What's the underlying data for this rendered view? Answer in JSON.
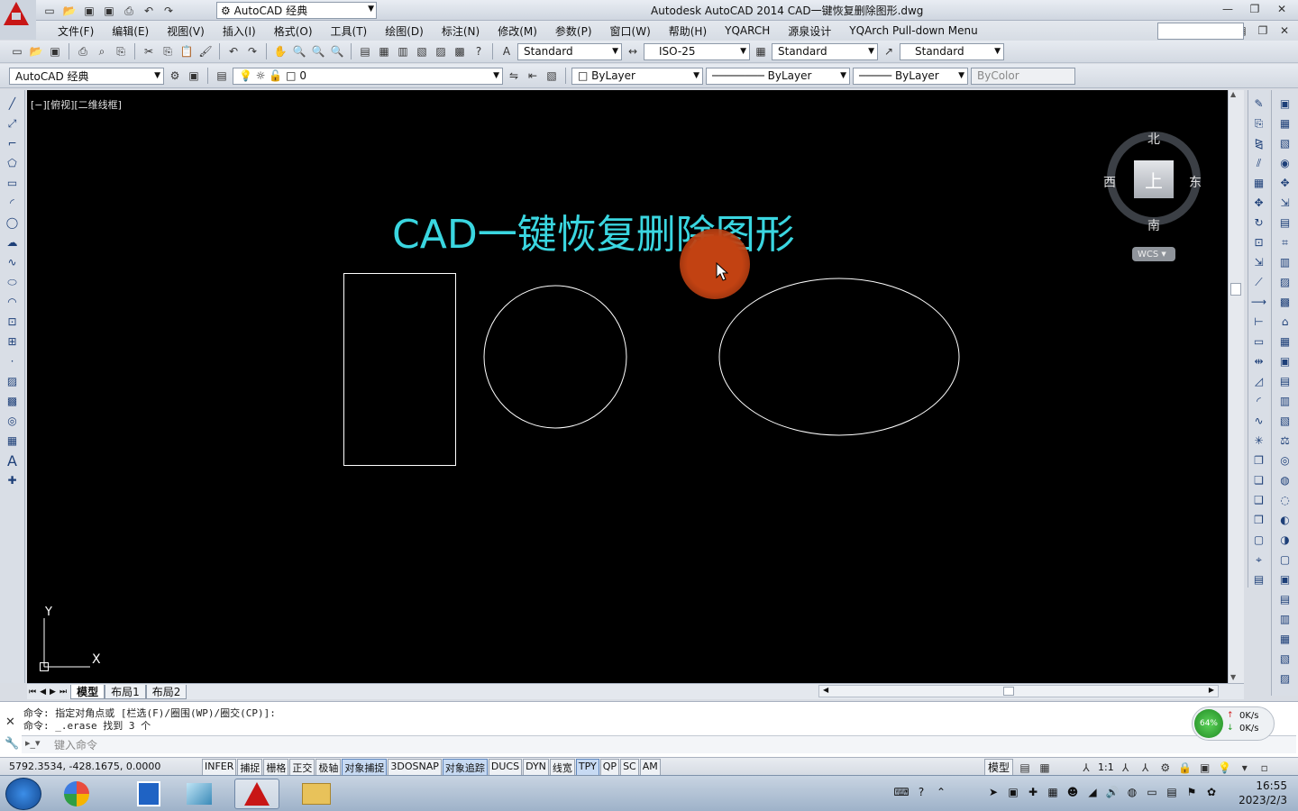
{
  "window": {
    "title": "Autodesk AutoCAD 2014     CAD一键恢复删除图形.dwg"
  },
  "workspace": {
    "selected": "AutoCAD 经典"
  },
  "menu": {
    "items": [
      "文件(F)",
      "编辑(E)",
      "视图(V)",
      "插入(I)",
      "格式(O)",
      "工具(T)",
      "绘图(D)",
      "标注(N)",
      "修改(M)",
      "参数(P)",
      "窗口(W)",
      "帮助(H)",
      "YQARCH",
      "源泉设计",
      "YQArch Pull-down Menu"
    ]
  },
  "styles": {
    "text_style": "Standard",
    "dim_style": "ISO-25",
    "table_style": "Standard",
    "mleader_style": "Standard"
  },
  "toolbar2": {
    "workspace": "AutoCAD 经典",
    "layer": "0",
    "color": "ByLayer",
    "linetype": "ByLayer",
    "lineweight": "ByLayer",
    "plotstyle": "ByColor"
  },
  "viewport": {
    "label": "[−][俯视][二维线框]",
    "mtext": "CAD一键恢复删除图形"
  },
  "viewcube": {
    "north": "北",
    "south": "南",
    "east": "东",
    "west": "西",
    "top": "上",
    "wcs": "WCS"
  },
  "ucs": {
    "x": "X",
    "y": "Y"
  },
  "layout_tabs": [
    "模型",
    "布局1",
    "布局2"
  ],
  "command": {
    "line1": "命令: 指定对角点或 [栏选(F)/圈围(WP)/圈交(CP)]:",
    "line2": "命令: _.erase 找到 3 个",
    "placeholder": "键入命令"
  },
  "net": {
    "percent": "64%",
    "up": "0K/s",
    "down": "0K/s"
  },
  "status": {
    "coords": "5792.3534, -428.1675, 0.0000",
    "buttons": [
      {
        "label": "INFER",
        "on": false
      },
      {
        "label": "捕捉",
        "on": false
      },
      {
        "label": "栅格",
        "on": false
      },
      {
        "label": "正交",
        "on": false
      },
      {
        "label": "极轴",
        "on": false
      },
      {
        "label": "对象捕捉",
        "on": true
      },
      {
        "label": "3DOSNAP",
        "on": false
      },
      {
        "label": "对象追踪",
        "on": true
      },
      {
        "label": "DUCS",
        "on": false
      },
      {
        "label": "DYN",
        "on": false
      },
      {
        "label": "线宽",
        "on": false
      },
      {
        "label": "TPY",
        "on": true
      },
      {
        "label": "QP",
        "on": false
      },
      {
        "label": "SC",
        "on": false
      },
      {
        "label": "AM",
        "on": false
      }
    ],
    "model": "模型",
    "scale": "1:1"
  },
  "taskbar": {
    "time": "16:55",
    "date": "2023/2/3"
  }
}
